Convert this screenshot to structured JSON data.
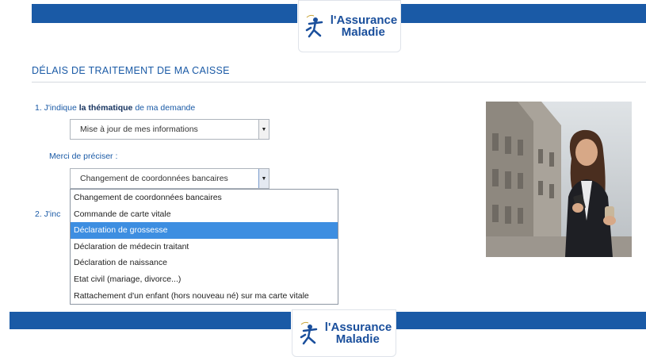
{
  "brand": {
    "name_line1": "l'Assurance",
    "name_line2": "Maladie",
    "color": "#1a5aa6"
  },
  "section": {
    "title": "DÉLAIS DE TRAITEMENT DE MA CAISSE"
  },
  "question1": {
    "prefix": "1. J'indique ",
    "bold": "la thématique",
    "suffix": " de ma demande"
  },
  "select1": {
    "value": "Mise à jour de mes informations"
  },
  "merci_label": "Merci de préciser :",
  "select2": {
    "value": "Changement de coordonnées bancaires"
  },
  "question2": {
    "visible_text": "2. J'inc"
  },
  "dropdown": {
    "options": [
      "Changement de coordonnées bancaires",
      "Commande de carte vitale",
      "Déclaration de grossesse",
      "Déclaration de médecin traitant",
      "Déclaration de naissance",
      "Etat civil (mariage, divorce...)",
      "Rattachement d'un enfant (hors nouveau né) sur ma carte vitale"
    ],
    "highlighted_index": 2,
    "highlight_color": "#3d8ee1"
  },
  "icons": {
    "select_arrow": "chevron-down-icon",
    "photo": "woman-with-phone-image"
  }
}
